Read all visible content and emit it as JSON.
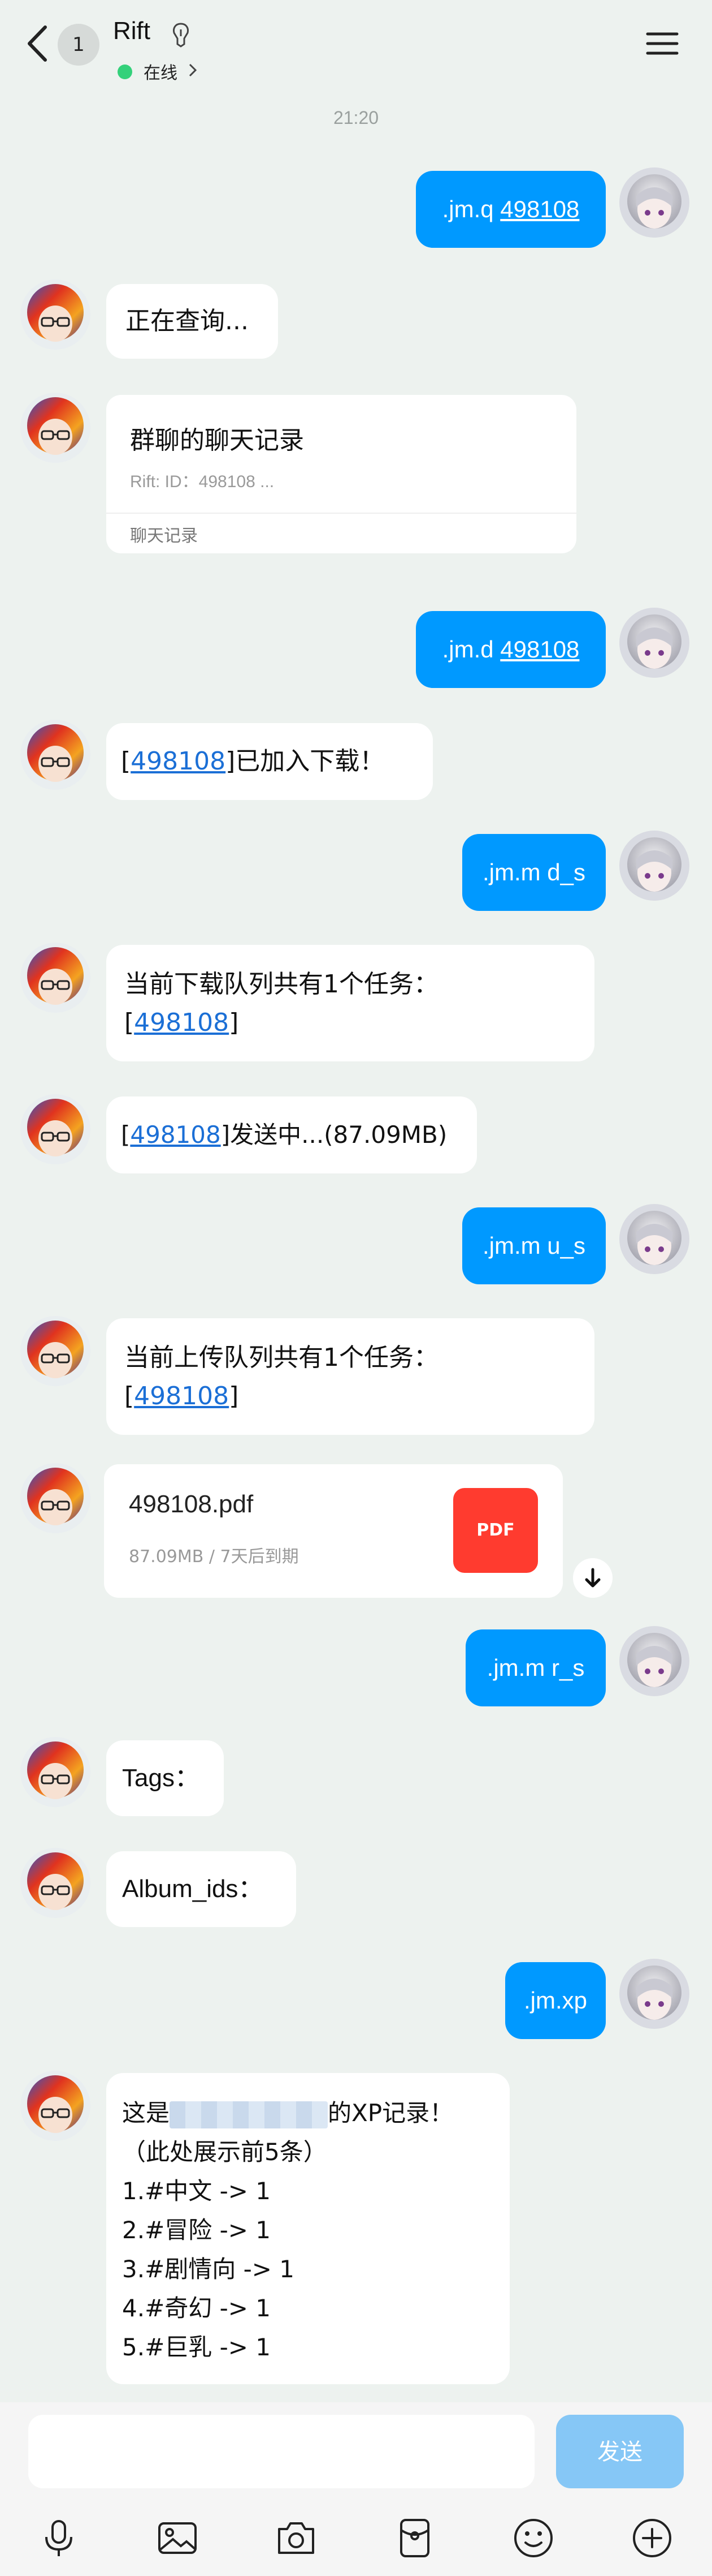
{
  "header": {
    "unread_count": "1",
    "title": "Rift",
    "status": "在线"
  },
  "time": "21:20",
  "messages": [
    {
      "id": "m1",
      "from": "me",
      "prefix": ".jm.q ",
      "link": "498108"
    },
    {
      "id": "m2",
      "from": "bot",
      "text": "正在查询..."
    },
    {
      "id": "m3",
      "from": "bot",
      "type": "card",
      "title": "群聊的聊天记录",
      "sub": "Rift: ID：498108 ...",
      "foot": "聊天记录"
    },
    {
      "id": "m4",
      "from": "me",
      "prefix": ".jm.d ",
      "link": "498108"
    },
    {
      "id": "m5",
      "from": "bot",
      "pre": "[",
      "link": "498108",
      "post": "]已加入下载！"
    },
    {
      "id": "m6",
      "from": "me",
      "text": ".jm.m d_s"
    },
    {
      "id": "m7",
      "from": "bot",
      "line1": "当前下载队列共有1个任务：",
      "pre": "[",
      "link": "498108",
      "post": "]"
    },
    {
      "id": "m8",
      "from": "bot",
      "pre": "[",
      "link": "498108",
      "post": "]发送中...(87.09MB)"
    },
    {
      "id": "m9",
      "from": "me",
      "text": ".jm.m u_s"
    },
    {
      "id": "m10",
      "from": "bot",
      "line1": "当前上传队列共有1个任务：",
      "pre": "[",
      "link": "498108",
      "post": "]"
    },
    {
      "id": "m11",
      "from": "bot",
      "type": "file",
      "name": "498108.pdf",
      "meta": "87.09MB / 7天后到期",
      "badge": "PDF"
    },
    {
      "id": "m12",
      "from": "me",
      "text": ".jm.m r_s"
    },
    {
      "id": "m13",
      "from": "bot",
      "text": "Tags："
    },
    {
      "id": "m14",
      "from": "bot",
      "text": "Album_ids："
    },
    {
      "id": "m15",
      "from": "me",
      "text": ".jm.xp"
    },
    {
      "id": "m16",
      "from": "bot",
      "line1_pre": "这是",
      "line1_post": "的XP记录！",
      "lines": [
        "（此处展示前5条）",
        "1.#中文 -> 1",
        "2.#冒险 -> 1",
        "3.#剧情向 -> 1",
        "4.#奇幻 -> 1",
        "5.#巨乳 -> 1"
      ]
    }
  ],
  "input": {
    "placeholder": "",
    "value": ""
  },
  "send_label": "发送",
  "icons": [
    "chevron-left-icon",
    "pin-icon",
    "menu-icon",
    "mic-icon",
    "image-icon",
    "camera-icon",
    "red-packet-icon",
    "emoji-icon",
    "plus-icon"
  ],
  "colors": {
    "background": "#edf2ef",
    "my_bubble": "#0099ff",
    "link": "#1b6fd6",
    "online": "#33d17a",
    "pdf": "#ff3b2f",
    "send_button": "#86c7f6"
  }
}
